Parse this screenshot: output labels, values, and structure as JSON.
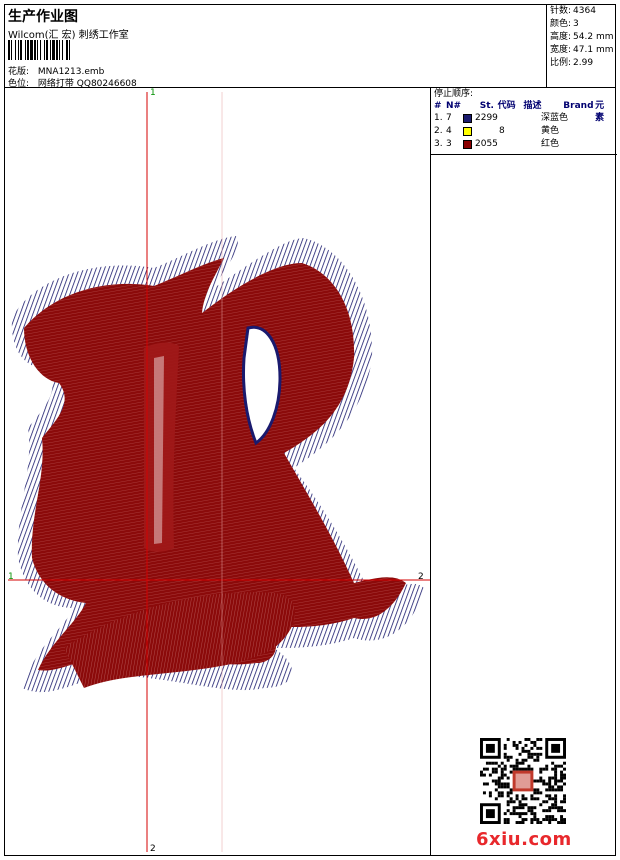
{
  "header": {
    "title": "生产作业图",
    "subtitle": "Wilcom(汇 宏) 刺绣工作室",
    "design_label": "花版:",
    "design_value": "MNA1213.emb",
    "color_label": "色位:",
    "color_value": "网络打带 QQ80246608"
  },
  "stats": [
    {
      "label": "针数:",
      "value": "4364"
    },
    {
      "label": "颜色:",
      "value": "3"
    },
    {
      "label": "高度:",
      "value": "54.2 mm"
    },
    {
      "label": "宽度:",
      "value": "47.1 mm"
    },
    {
      "label": "比例:",
      "value": "2.99"
    }
  ],
  "stop_sequence": {
    "title": "停止顺序:",
    "columns": [
      "#",
      "N#",
      "St.",
      "代码",
      "描述",
      "Brand",
      "元素"
    ],
    "rows": [
      {
        "num": "1.",
        "n": "7",
        "st": "",
        "code": "2299",
        "desc": "深蓝色",
        "color": "#1a1a6e"
      },
      {
        "num": "2.",
        "n": "4",
        "st": "",
        "code": "8",
        "desc": "黄色",
        "color": "#ffff00"
      },
      {
        "num": "3.",
        "n": "3",
        "st": "",
        "code": "2055",
        "desc": "红色",
        "color": "#8b0000"
      }
    ]
  },
  "crosshair": {
    "top_label": "1",
    "bottom_label": "2",
    "left_label": "1",
    "right_label": "2"
  },
  "watermark": "6xiu.com",
  "colors": {
    "navy": "#1a1a6e",
    "maroon": "#8b0a0a",
    "guide": "#d40000"
  }
}
